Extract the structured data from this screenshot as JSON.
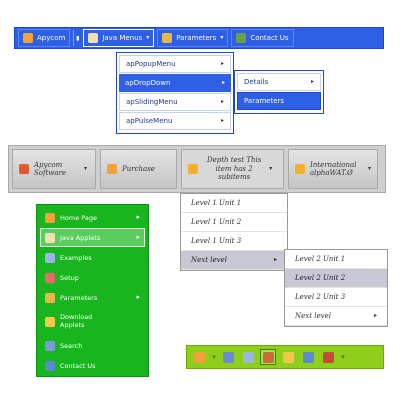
{
  "blue_menu": {
    "items": [
      {
        "label": "Apycom",
        "icon": "home-icon"
      },
      {
        "label": "Java Menus",
        "icon": "book-icon"
      },
      {
        "label": "Parameters",
        "icon": "gear-icon"
      },
      {
        "label": "Contact Us",
        "icon": "people-icon"
      }
    ],
    "submenu": [
      "apPopupMenu",
      "apDropDown",
      "apSlidingMenu",
      "apPulseMenu"
    ],
    "submenu2": [
      "Details",
      "Parameters"
    ]
  },
  "grey_menu": {
    "items": [
      {
        "label": "Apycom Software",
        "icon": "grid-icon"
      },
      {
        "label": "Purchase",
        "icon": "cart-icon"
      },
      {
        "label": "Depth test This item has 2 subitems",
        "icon": "folder-icon"
      },
      {
        "label": "International alphaWAT.Ø",
        "icon": "globe-icon"
      }
    ],
    "submenu": [
      "Level 1 Unit 1",
      "Level 1 Unit 2",
      "Level 1 Unit 3",
      "Next level"
    ],
    "submenu2": [
      "Level 2 Unit 1",
      "Level 2 Unit 2",
      "Level 2 Unit 3",
      "Next level"
    ]
  },
  "green_menu": {
    "items": [
      {
        "label": "Home Page",
        "icon": "home-icon"
      },
      {
        "label": "Java Applets",
        "icon": "book-icon"
      },
      {
        "label": "Examples",
        "icon": "screen-icon"
      },
      {
        "label": "Setup",
        "icon": "setup-icon"
      },
      {
        "label": "Parameters",
        "icon": "gear-icon"
      },
      {
        "label": "Download Applets",
        "icon": "download-icon"
      },
      {
        "label": "Search",
        "icon": "search-icon"
      },
      {
        "label": "Contact Us",
        "icon": "mail-icon"
      }
    ]
  },
  "colors": {
    "blue": "#2e5fe4",
    "green": "#19b51f",
    "lime": "#8fce1d",
    "grey": "#cfcfcf"
  }
}
